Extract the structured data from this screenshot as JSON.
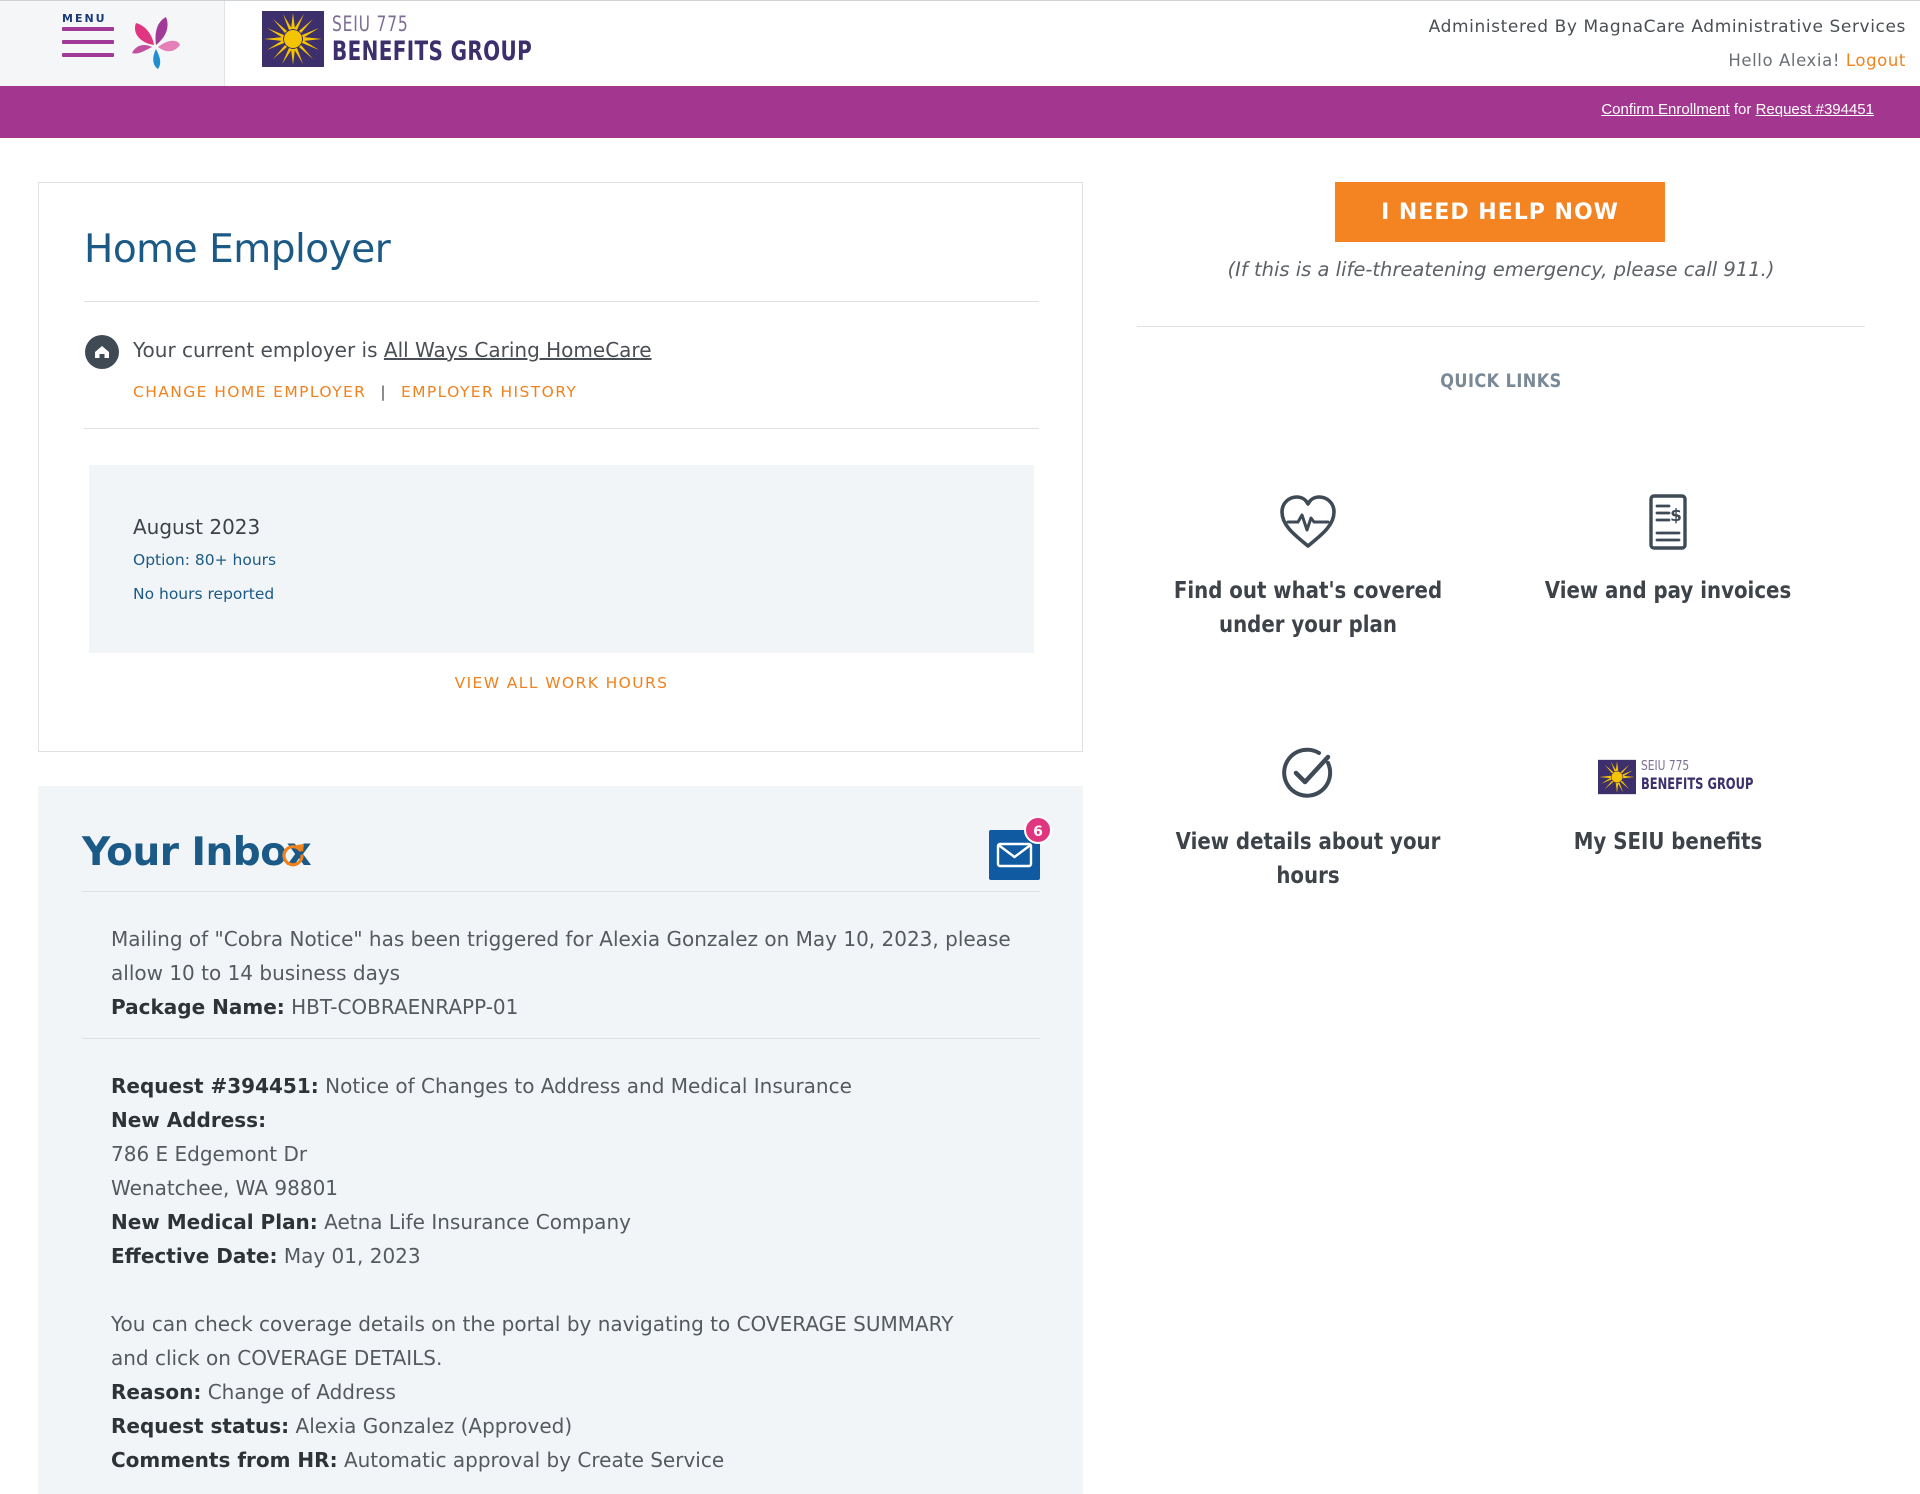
{
  "header": {
    "menu_label": "MENU",
    "brand_line1": "SEIU 775",
    "brand_line2": "BENEFITS GROUP",
    "administered_by": "Administered By MagnaCare Administrative Services",
    "greeting": "Hello Alexia!",
    "logout_label": "Logout"
  },
  "notice_bar": {
    "confirm_link": "Confirm Enrollment",
    "for_text": "for",
    "request_link": "Request #394451"
  },
  "home_employer": {
    "title": "Home Employer",
    "current_prefix": "Your current employer is",
    "employer_name": "All Ways Caring HomeCare",
    "change_label": "CHANGE HOME EMPLOYER",
    "separator": "|",
    "history_label": "EMPLOYER HISTORY",
    "hours": {
      "month": "August 2023",
      "option": "Option: 80+ hours",
      "status": "No hours reported"
    },
    "view_all_label": "VIEW ALL WORK HOURS"
  },
  "inbox": {
    "title": "Your Inbox",
    "unread_count": "6",
    "messages": [
      {
        "text": "Mailing of \"Cobra Notice\" has been triggered for Alexia Gonzalez on May 10, 2023, please allow 10 to 14 business days",
        "package_label": "Package Name:",
        "package_value": "HBT-COBRAENRAPP-01"
      },
      {
        "request_label": "Request #394451:",
        "request_value": "Notice of Changes to Address and Medical Insurance",
        "address_label": "New Address:",
        "address_line1": "786 E Edgemont Dr",
        "address_line2": "Wenatchee, WA 98801",
        "plan_label": "New Medical Plan:",
        "plan_value": "Aetna Life Insurance Company",
        "effective_label": "Effective Date:",
        "effective_value": "May 01, 2023",
        "coverage_note": "You can check coverage details on the portal by navigating to COVERAGE SUMMARY and click on COVERAGE DETAILS.",
        "reason_label": "Reason:",
        "reason_value": "Change of Address",
        "status_label": "Request status:",
        "status_value": "Alexia Gonzalez (Approved)",
        "comments_label": "Comments from HR:",
        "comments_value": "Automatic approval by Create Service"
      }
    ]
  },
  "help": {
    "button_label": "I NEED HELP NOW",
    "emergency_note": "(If this is a life-threatening emergency, please call 911.)"
  },
  "quick_links": {
    "title": "QUICK LINKS",
    "items": [
      {
        "label": "Find out what's covered under your plan",
        "icon": "heartbeat-icon"
      },
      {
        "label": "View and pay invoices",
        "icon": "invoice-icon"
      },
      {
        "label": "View details about your hours",
        "icon": "check-circle-icon"
      },
      {
        "label": "My SEIU benefits",
        "icon": "seiu-logo-icon",
        "logo_line1": "SEIU 775",
        "logo_line2": "BENEFITS GROUP"
      }
    ]
  },
  "colors": {
    "purple_bar": "#a3368f",
    "accent_orange": "#f48322",
    "heading_blue": "#1b5a86",
    "badge_pink": "#e0357f"
  }
}
